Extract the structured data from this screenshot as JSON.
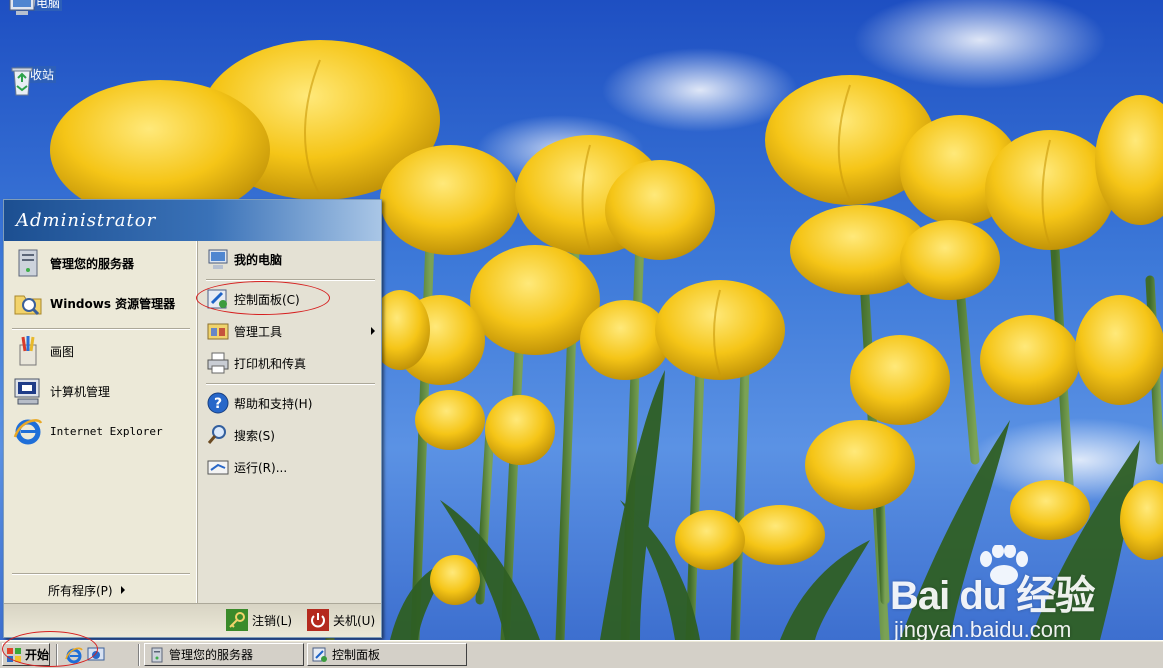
{
  "desktop": {
    "icons": [
      {
        "label": "我的电脑",
        "icon": "my-computer-icon"
      },
      {
        "label": "回收站",
        "icon": "recycle-bin-icon"
      }
    ]
  },
  "start_menu": {
    "user": "Administrator",
    "left_items": [
      {
        "label": "管理您的服务器",
        "icon": "server-manage-icon"
      },
      {
        "label": "Windows 资源管理器",
        "icon": "explorer-folder-icon"
      },
      {
        "label": "画图",
        "icon": "paint-icon"
      },
      {
        "label": "计算机管理",
        "icon": "computer-management-icon"
      },
      {
        "label": "Internet Explorer",
        "icon": "internet-explorer-icon"
      }
    ],
    "all_programs": "所有程序(P)",
    "right_items": [
      {
        "label": "我的电脑",
        "icon": "my-computer-icon"
      },
      {
        "label": "控制面板(C)",
        "icon": "control-panel-icon"
      },
      {
        "label": "管理工具",
        "icon": "admin-tools-icon"
      },
      {
        "label": "打印机和传真",
        "icon": "printer-icon"
      },
      {
        "label": "帮助和支持(H)",
        "icon": "help-icon"
      },
      {
        "label": "搜索(S)",
        "icon": "search-icon"
      },
      {
        "label": "运行(R)...",
        "icon": "run-icon"
      }
    ],
    "footer": {
      "logoff": "注销(L)",
      "shutdown": "关机(U)"
    }
  },
  "taskbar": {
    "start_label": "开始",
    "tasks": [
      {
        "label": "管理您的服务器",
        "icon": "server-manage-icon"
      },
      {
        "label": "控制面板",
        "icon": "control-panel-icon"
      }
    ]
  },
  "watermark": {
    "logo_text": "Bai du 经验",
    "url": "jingyan.baidu.com"
  },
  "colors": {
    "annotation": "#d62020",
    "menu_header": "#1c4f91",
    "taskbar": "#d4d0c8"
  }
}
